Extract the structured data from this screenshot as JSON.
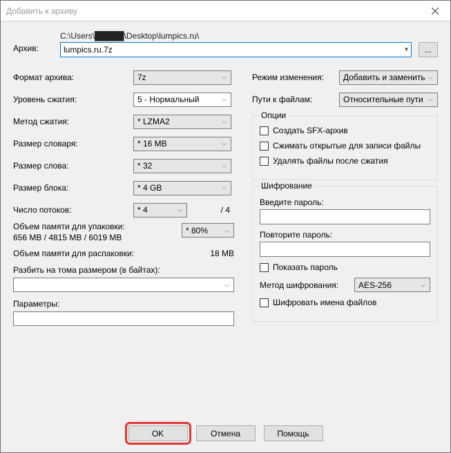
{
  "window": {
    "title": "Добавить к архиву"
  },
  "archive": {
    "label": "Архив:",
    "path": "C:\\Users\\█████\\Desktop\\lumpics.ru\\",
    "filename": "lumpics.ru.7z",
    "browse": "..."
  },
  "left": {
    "format_label": "Формат архива:",
    "format_value": "7z",
    "level_label": "Уровень сжатия:",
    "level_value": "5 - Нормальный",
    "method_label": "Метод сжатия:",
    "method_value": "* LZMA2",
    "dict_label": "Размер словаря:",
    "dict_value": "* 16 MB",
    "word_label": "Размер слова:",
    "word_value": "* 32",
    "block_label": "Размер блока:",
    "block_value": "* 4 GB",
    "threads_label": "Число потоков:",
    "threads_value": "* 4",
    "threads_max": "/ 4",
    "mempack_label": "Объем памяти для упаковки:",
    "mempack_detail": "656 MB / 4815 MB / 6019 MB",
    "mempack_value": "* 80%",
    "memunpack_label": "Объем памяти для распаковки:",
    "memunpack_value": "18 MB",
    "split_label": "Разбить на тома размером (в байтах):",
    "params_label": "Параметры:"
  },
  "right": {
    "update_label": "Режим изменения:",
    "update_value": "Добавить и заменить",
    "paths_label": "Пути к файлам:",
    "paths_value": "Относительные пути",
    "options_title": "Опции",
    "opt_sfx": "Создать SFX-архив",
    "opt_open": "Сжимать открытые для записи файлы",
    "opt_delete": "Удалять файлы после сжатия",
    "enc_title": "Шифрование",
    "pw1_label": "Введите пароль:",
    "pw2_label": "Повторите пароль:",
    "show_pw": "Показать пароль",
    "enc_method_label": "Метод шифрования:",
    "enc_method_value": "AES-256",
    "enc_names": "Шифровать имена файлов"
  },
  "buttons": {
    "ok": "OK",
    "cancel": "Отмена",
    "help": "Помощь"
  }
}
